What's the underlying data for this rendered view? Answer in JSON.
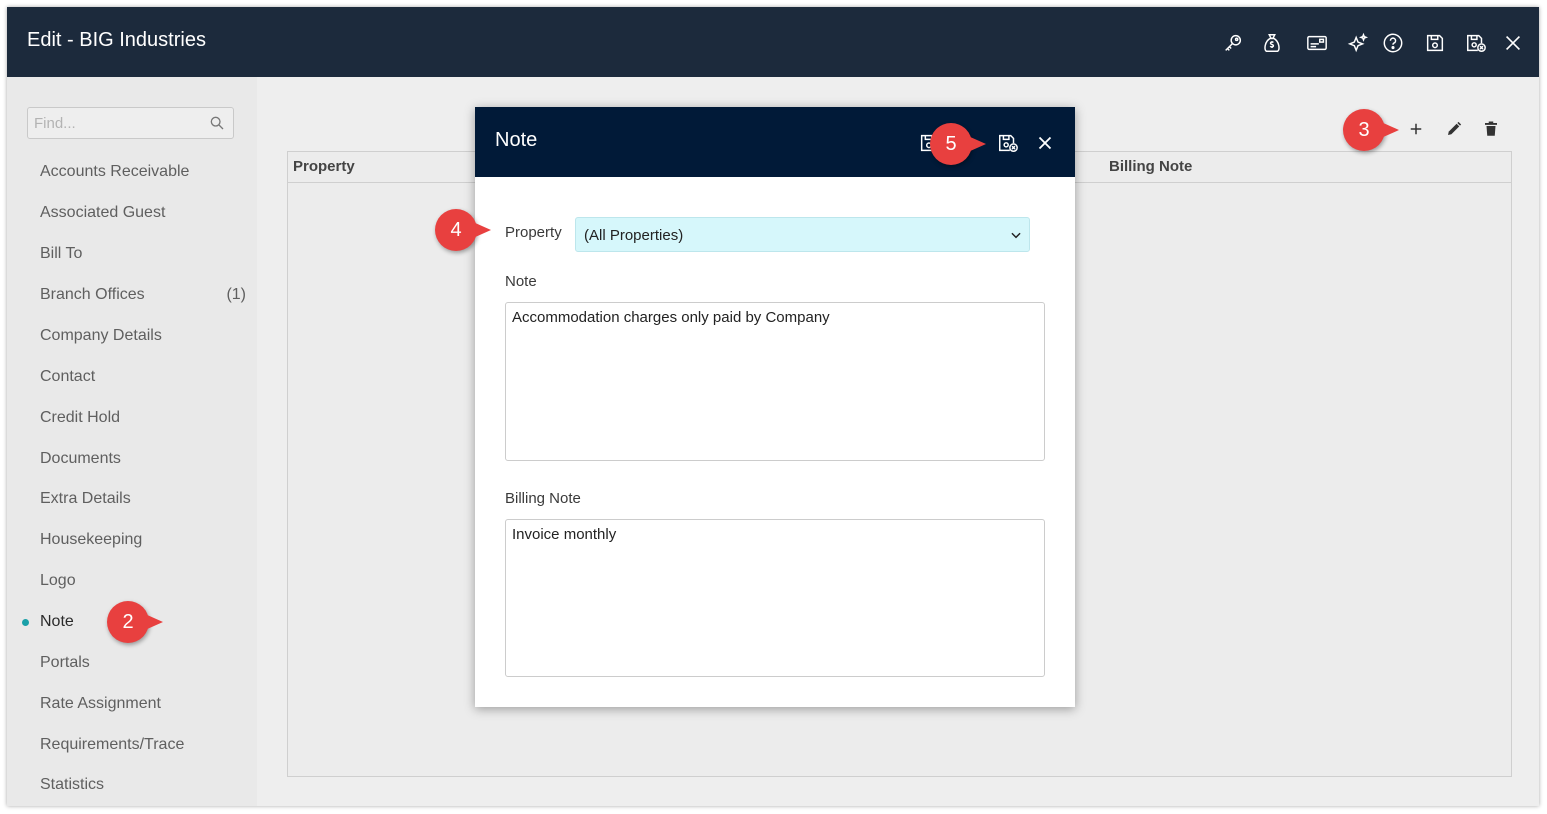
{
  "window": {
    "title": "Edit - BIG Industries",
    "toolbar_icons": [
      "key-icon",
      "money-bag-icon",
      "card-icon",
      "sparkle-icon",
      "help-icon",
      "save-icon",
      "save-close-icon",
      "close-icon"
    ]
  },
  "sidebar": {
    "search_placeholder": "Find...",
    "items": [
      {
        "label": "Accounts Receivable"
      },
      {
        "label": "Associated Guest"
      },
      {
        "label": "Bill To"
      },
      {
        "label": "Branch Offices",
        "count": "(1)"
      },
      {
        "label": "Company Details"
      },
      {
        "label": "Contact"
      },
      {
        "label": "Credit Hold"
      },
      {
        "label": "Documents"
      },
      {
        "label": "Extra Details"
      },
      {
        "label": "Housekeeping"
      },
      {
        "label": "Logo"
      },
      {
        "label": "Note",
        "active": true
      },
      {
        "label": "Portals"
      },
      {
        "label": "Rate Assignment"
      },
      {
        "label": "Requirements/Trace"
      },
      {
        "label": "Statistics"
      }
    ]
  },
  "grid": {
    "columns": [
      "Property",
      "Billing Note"
    ],
    "toolbar_icons": [
      "add-icon",
      "edit-icon",
      "delete-icon"
    ]
  },
  "modal": {
    "title": "Note",
    "property_label": "Property",
    "property_value": "(All Properties)",
    "note_label": "Note",
    "note_value": "Accommodation charges only paid by Company",
    "billing_note_label": "Billing Note",
    "billing_note_value": "Invoice monthly"
  },
  "callouts": [
    "2",
    "3",
    "4",
    "5"
  ],
  "colors": {
    "titlebar": "#1c2a3c",
    "modal_header": "#011a38",
    "select_bg": "#d6f7fb",
    "callout": "#e8403f",
    "active_dot": "#1aa0a8"
  }
}
